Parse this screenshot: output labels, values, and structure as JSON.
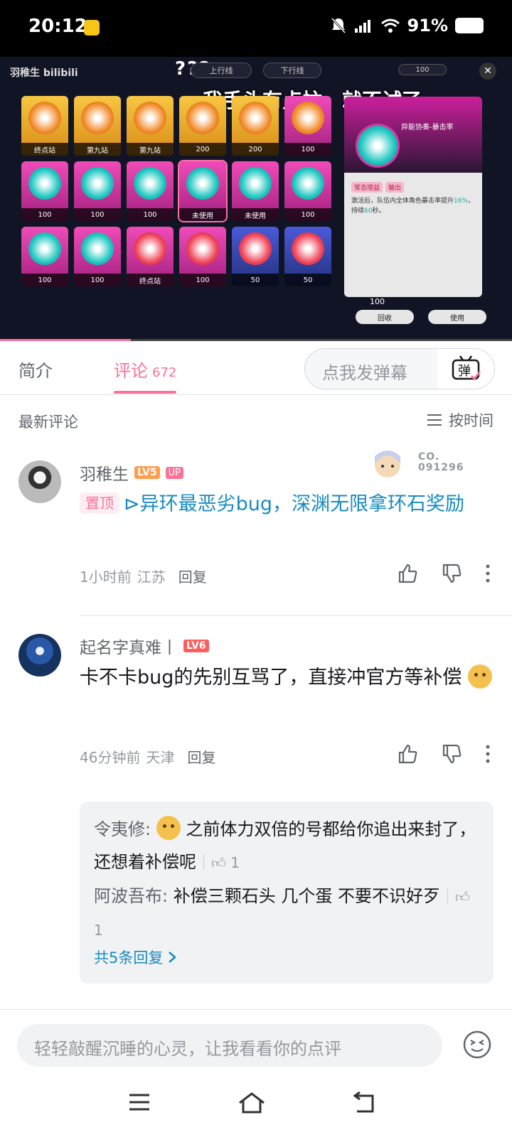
{
  "status_bar": {
    "time": "20:12",
    "network": "5G",
    "battery": "91%"
  },
  "video": {
    "watermark": "羽稚生 bilibili",
    "question_marks": "???",
    "pill_up": "上行线",
    "pill_down": "下行线",
    "currency": "100",
    "subtitle": "我手头有点忙，就不试了",
    "tiles": [
      {
        "label": "终点站",
        "style": "gold"
      },
      {
        "label": "第九站",
        "style": "gold"
      },
      {
        "label": "第九站",
        "style": "gold"
      },
      {
        "label": "200",
        "style": "gold"
      },
      {
        "label": "200",
        "style": "gold"
      },
      {
        "label": "100",
        "style": "pink"
      },
      {
        "label": "100",
        "style": "pink teal"
      },
      {
        "label": "100",
        "style": "pink teal"
      },
      {
        "label": "100",
        "style": "pink teal"
      },
      {
        "label": "未使用",
        "style": "pink teal sel"
      },
      {
        "label": "未使用",
        "style": "pink teal"
      },
      {
        "label": "100",
        "style": "pink teal"
      },
      {
        "label": "100",
        "style": "pink teal"
      },
      {
        "label": "100",
        "style": "pink teal"
      },
      {
        "label": "终点站",
        "style": "pink red"
      },
      {
        "label": "100",
        "style": "pink red"
      },
      {
        "label": "50",
        "style": "blue red"
      },
      {
        "label": "50",
        "style": "blue red"
      }
    ],
    "panel_title": "异能协奏-暴击率",
    "panel_tags": [
      "常态增益",
      "输出"
    ],
    "panel_desc_a": "激活后，队伍内全体角色暴击率提升",
    "panel_desc_pct": "16%",
    "panel_desc_b": "，持续",
    "panel_desc_sec": "60",
    "panel_desc_c": "秒。",
    "panel_cost": "100",
    "btn_recycle": "回收",
    "btn_use": "使用",
    "progress_fraction": 0.255
  },
  "tabs": {
    "intro": "简介",
    "comments": "评论",
    "comment_count": "672",
    "danmaku_placeholder": "点我发弹幕",
    "danmaku_icon_text": "弹"
  },
  "sort": {
    "title": "最新评论",
    "by_time": "按时间"
  },
  "comments": [
    {
      "user": "羽稚生",
      "level": "LV5",
      "badge": "UP",
      "pinned": "置顶",
      "text": "异环最恶劣bug，深渊无限拿环石奖励",
      "time": "1小时前",
      "location": "江苏",
      "reply": "回复",
      "decor_number": "CO. 091296"
    },
    {
      "user": "起名字真难丨",
      "level": "LV6",
      "text": "卡不卡bug的先别互骂了，直接冲官方等补偿",
      "time": "46分钟前",
      "location": "天津",
      "reply": "回复",
      "replies": [
        {
          "user": "令夷修",
          "text_a": "之前体力双倍的号都给你追出来封了，还想着补偿呢",
          "likes": "1"
        },
        {
          "user": "阿波吾布",
          "text_a": "补偿三颗石头 几个蛋 不要不识好歹",
          "likes": "1"
        }
      ],
      "more_replies": "共5条回复"
    }
  ],
  "input": {
    "placeholder": "轻轻敲醒沉睡的心灵，让我看看你的点评"
  },
  "icons": {
    "like": "thumbs-up-icon",
    "dislike": "thumbs-down-icon",
    "more": "more-vertical-icon",
    "sort": "list-icon",
    "emoji": "emoji-icon"
  },
  "colors": {
    "accent_pink": "#fb7299",
    "link_blue": "#178bbf"
  }
}
